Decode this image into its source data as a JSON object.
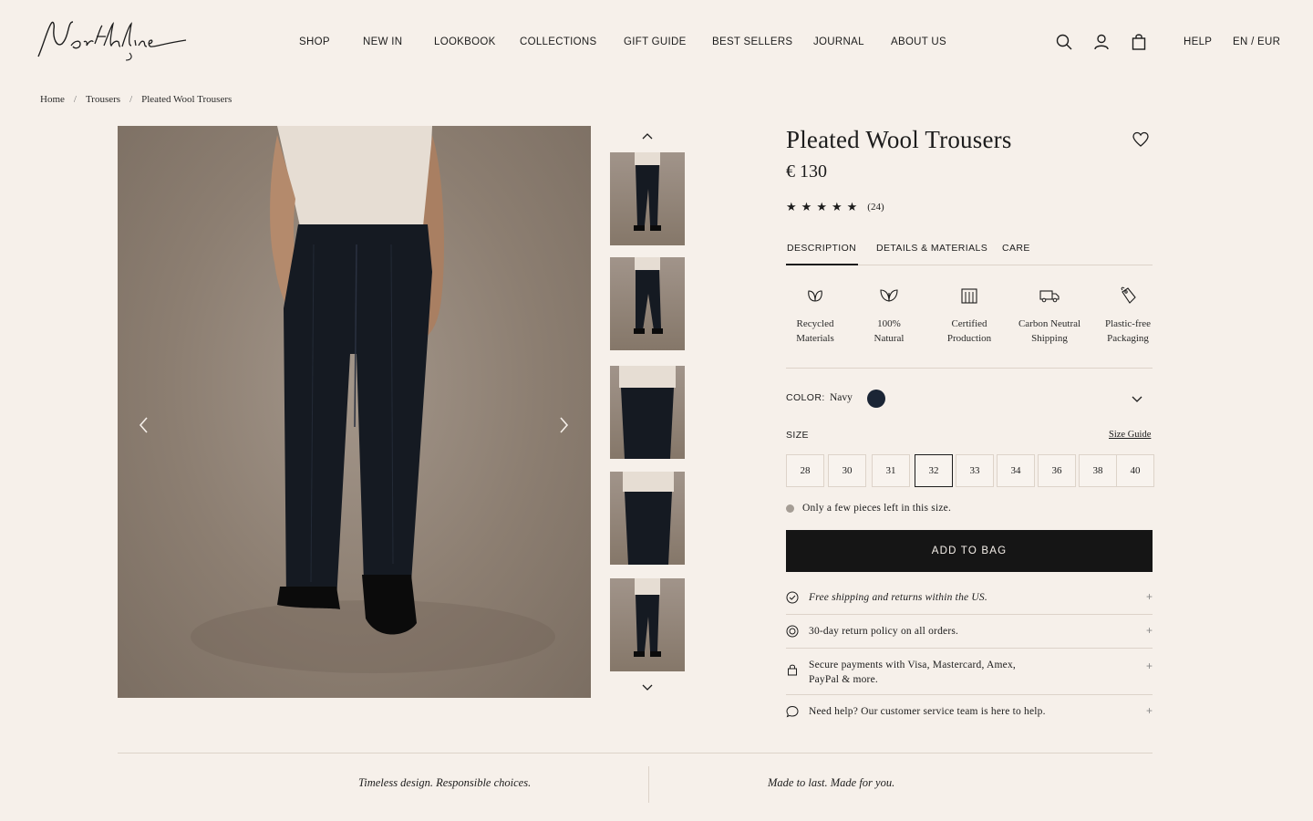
{
  "brand": {
    "logo_text": "Northline"
  },
  "nav": {
    "items": [
      "SHOP",
      "NEW IN",
      "LOOKBOOK",
      "COLLECTIONS",
      "GIFT GUIDE",
      "BEST SELLERS",
      "JOURNAL",
      "ABOUT US"
    ]
  },
  "header": {
    "icons": [
      "search-icon",
      "account-icon",
      "bag-icon"
    ],
    "help": "HELP",
    "locale": "EN / EUR"
  },
  "breadcrumb": {
    "items": [
      "Home",
      "Trousers",
      "Pleated Wool Trousers"
    ],
    "separator": "/"
  },
  "gallery": {
    "thumbnail_count": 5,
    "prev_icon": "chevron-left-icon",
    "next_icon": "chevron-right-icon"
  },
  "product": {
    "title": "Pleated Wool Trousers",
    "price": "€ 130",
    "rating_stars": 5,
    "review_count": "(24)"
  },
  "tabs": [
    "DESCRIPTION",
    "DETAILS & MATERIALS",
    "CARE"
  ],
  "active_tab": "DESCRIPTION",
  "features": [
    {
      "icon": "leaf-icon",
      "label": "Recycled\nMaterials"
    },
    {
      "icon": "leaves-icon",
      "label": "100%\nNatural"
    },
    {
      "icon": "factory-icon",
      "label": "Certified\nProduction"
    },
    {
      "icon": "truck-icon",
      "label": "Carbon Neutral\nShipping"
    },
    {
      "icon": "tag-icon",
      "label": "Plastic-free\nPackaging"
    }
  ],
  "color": {
    "label": "COLOR:",
    "value": "Navy",
    "swatch": "#1b2535"
  },
  "size": {
    "label": "SIZE",
    "guide": "Size Guide",
    "options": [
      "28",
      "30",
      "31",
      "32",
      "33",
      "34",
      "36",
      "38",
      "40"
    ],
    "selected": "32"
  },
  "stock_note": "Only a few pieces left in this size.",
  "add_to_bag": "ADD TO BAG",
  "info": [
    {
      "icon": "check-circle-icon",
      "text": "Free shipping and returns within the US."
    },
    {
      "icon": "return-icon",
      "text": "30-day return policy on all orders."
    },
    {
      "icon": "lock-icon",
      "text": "Secure payments with Visa, Mastercard, Amex,\nPayPal & more."
    },
    {
      "icon": "chat-icon",
      "text": "Need help? Our customer service team is here to help."
    }
  ],
  "footer": {
    "taglines": [
      "Timeless design. Responsible choices.",
      "Made to last. Made for you."
    ]
  },
  "colors": {
    "background": "#f6f0ea",
    "button": "#151515",
    "text": "#1c1c1c"
  }
}
